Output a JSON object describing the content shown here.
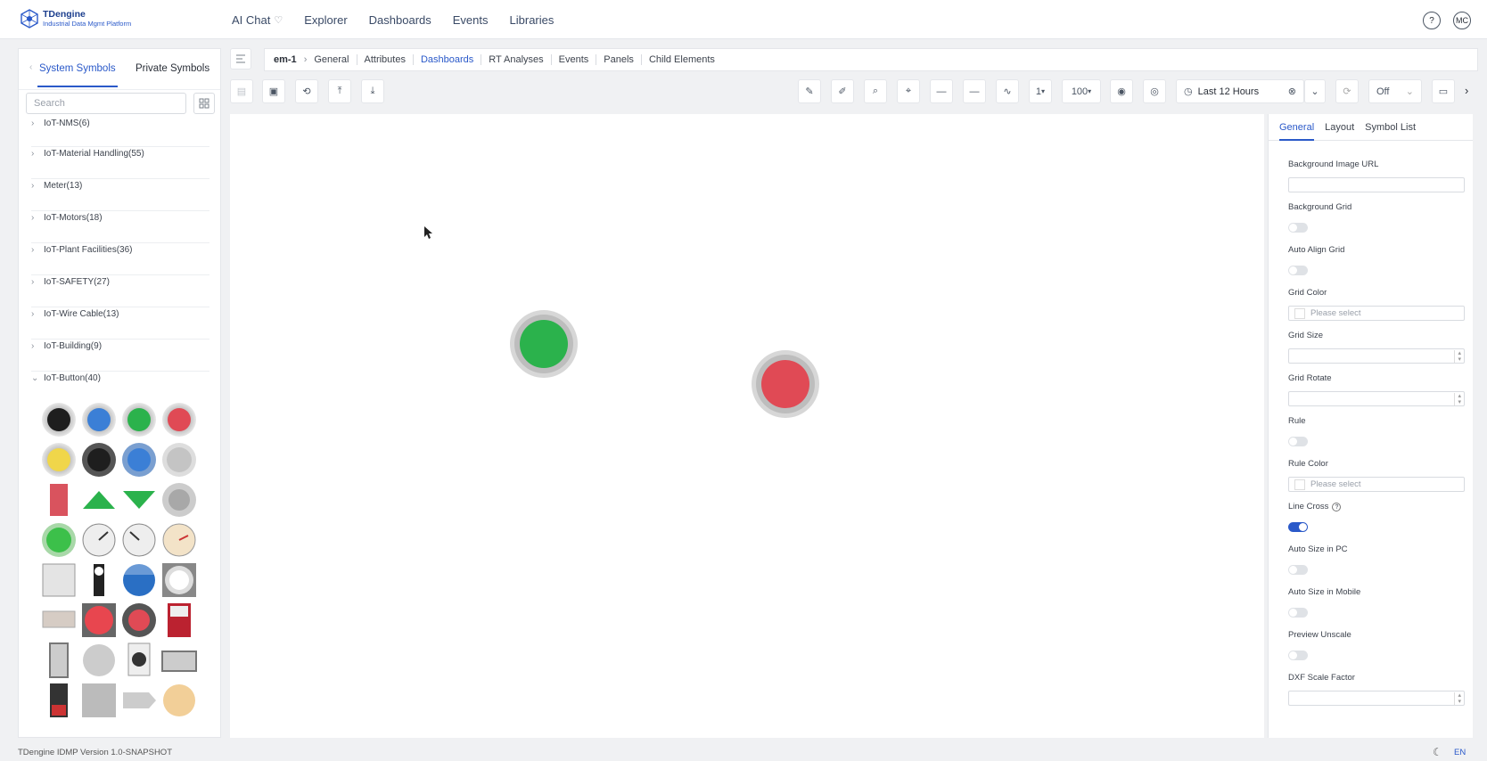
{
  "app": {
    "name": "TDengine",
    "subtitle": "Industrial Data Mgmt Platform"
  },
  "nav": {
    "items": [
      "AI Chat",
      "Explorer",
      "Dashboards",
      "Events",
      "Libraries"
    ],
    "help": "?",
    "avatar": "MC"
  },
  "sidebar": {
    "tabs": [
      "System Symbols",
      "Private Symbols"
    ],
    "search_placeholder": "Search",
    "categories": [
      "IoT-NMS(6)",
      "IoT-Material Handling(55)",
      "Meter(13)",
      "IoT-Motors(18)",
      "IoT-Plant Facilities(36)",
      "IoT-SAFETY(27)",
      "IoT-Wire Cable(13)",
      "IoT-Building(9)",
      "IoT-Button(40)"
    ]
  },
  "breadcrumb": {
    "root": "em-1",
    "items": [
      "General",
      "Attributes",
      "Dashboards",
      "RT Analyses",
      "Events",
      "Panels",
      "Child Elements"
    ],
    "active": "Dashboards"
  },
  "toolbar": {
    "line_width": "1",
    "zoom": "100",
    "time_range": "Last 12 Hours",
    "refresh": "Off"
  },
  "props": {
    "tabs": [
      "General",
      "Layout",
      "Symbol List"
    ],
    "background_image_url": "Background Image URL",
    "background_grid": "Background Grid",
    "auto_align_grid": "Auto Align Grid",
    "grid_color": "Grid Color",
    "grid_size": "Grid Size",
    "grid_rotate": "Grid Rotate",
    "rule": "Rule",
    "rule_color": "Rule Color",
    "line_cross": "Line Cross",
    "auto_size_pc": "Auto Size in PC",
    "auto_size_mobile": "Auto Size in Mobile",
    "preview_unscale": "Preview Unscale",
    "dxf_scale_factor": "DXF Scale Factor",
    "please_select": "Please select",
    "line_cross_enabled": true
  },
  "colors": {
    "accent": "#2a59c9",
    "green_button": "#2bb24c",
    "red_button": "#e04a55"
  },
  "footer": {
    "version": "TDengine IDMP Version 1.0-SNAPSHOT",
    "lang": "EN"
  }
}
